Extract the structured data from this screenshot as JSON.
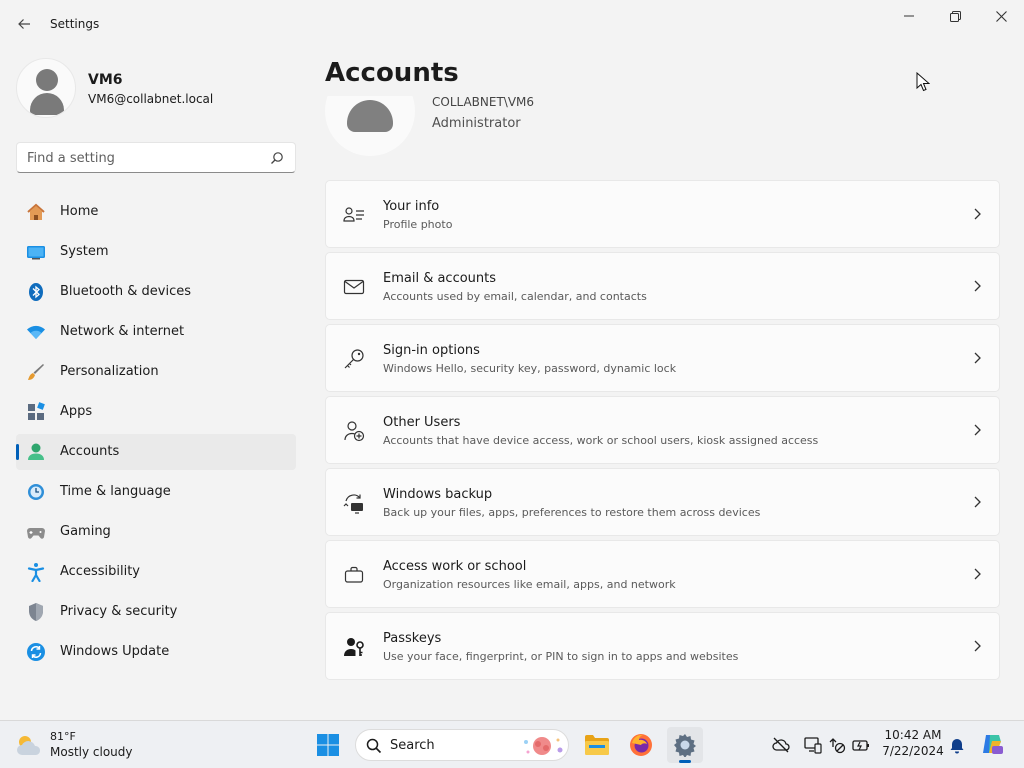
{
  "window": {
    "title": "Settings"
  },
  "profile": {
    "name": "VM6",
    "email": "VM6@collabnet.local"
  },
  "search": {
    "placeholder": "Find a setting"
  },
  "nav": {
    "items": [
      {
        "label": "Home",
        "icon": "home-icon"
      },
      {
        "label": "System",
        "icon": "system-icon"
      },
      {
        "label": "Bluetooth & devices",
        "icon": "bluetooth-icon"
      },
      {
        "label": "Network & internet",
        "icon": "wifi-icon"
      },
      {
        "label": "Personalization",
        "icon": "brush-icon"
      },
      {
        "label": "Apps",
        "icon": "apps-icon"
      },
      {
        "label": "Accounts",
        "icon": "accounts-icon",
        "active": true
      },
      {
        "label": "Time & language",
        "icon": "clock-globe-icon"
      },
      {
        "label": "Gaming",
        "icon": "gamepad-icon"
      },
      {
        "label": "Accessibility",
        "icon": "accessibility-icon"
      },
      {
        "label": "Privacy & security",
        "icon": "shield-icon"
      },
      {
        "label": "Windows Update",
        "icon": "update-icon"
      }
    ]
  },
  "main": {
    "title": "Accounts",
    "account": {
      "domain": "COLLABNET\\VM6",
      "role": "Administrator"
    },
    "cards": [
      {
        "title": "Your info",
        "subtitle": "Profile photo",
        "icon": "person-card-icon"
      },
      {
        "title": "Email & accounts",
        "subtitle": "Accounts used by email, calendar, and contacts",
        "icon": "mail-icon"
      },
      {
        "title": "Sign-in options",
        "subtitle": "Windows Hello, security key, password, dynamic lock",
        "icon": "key-icon"
      },
      {
        "title": "Other Users",
        "subtitle": "Accounts that have device access, work or school users, kiosk assigned access",
        "icon": "person-add-icon"
      },
      {
        "title": "Windows backup",
        "subtitle": "Back up your files, apps, preferences to restore them across devices",
        "icon": "backup-icon"
      },
      {
        "title": "Access work or school",
        "subtitle": "Organization resources like email, apps, and network",
        "icon": "briefcase-icon"
      },
      {
        "title": "Passkeys",
        "subtitle": "Use your face, fingerprint, or PIN to sign in to apps and websites",
        "icon": "passkey-icon"
      }
    ]
  },
  "taskbar": {
    "weather": {
      "temp": "81°F",
      "desc": "Mostly cloudy"
    },
    "search_label": "Search",
    "clock": {
      "time": "10:42 AM",
      "date": "7/22/2024"
    }
  },
  "colors": {
    "accent": "#005fb8",
    "window_bg": "#f3f3f3",
    "card_bg": "#fbfbfb"
  }
}
